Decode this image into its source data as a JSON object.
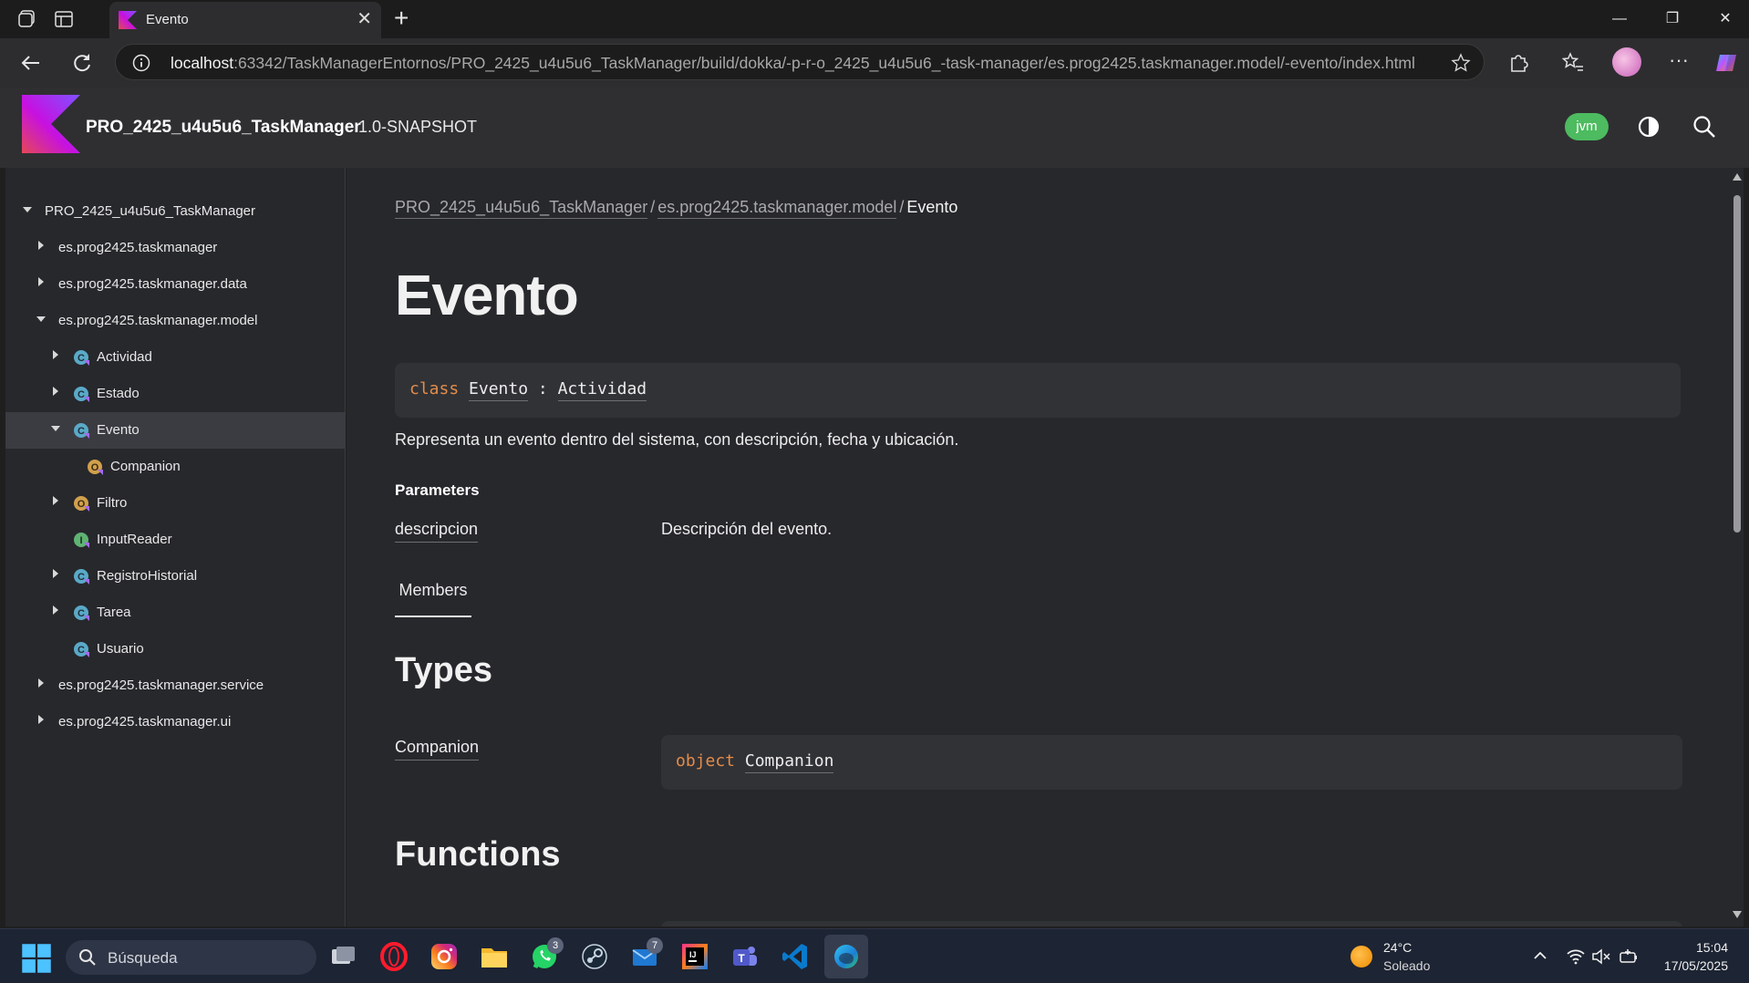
{
  "browser": {
    "tab_title": "Evento",
    "url_host": "localhost",
    "url_rest": ":63342/TaskManagerEntornos/PRO_2425_u4u5u6_TaskManager/build/dokka/-p-r-o_2425_u4u5u6_-task-manager/es.prog2425.taskmanager.model/-evento/index.html"
  },
  "header": {
    "project": "PRO_2425_u4u5u6_TaskManager",
    "version": "1.0-SNAPSHOT",
    "platform_badge": "jvm"
  },
  "sidebar": {
    "items": [
      {
        "label": "PRO_2425_u4u5u6_TaskManager",
        "expanded": true
      },
      {
        "label": "es.prog2425.taskmanager",
        "expanded": false
      },
      {
        "label": "es.prog2425.taskmanager.data",
        "expanded": false
      },
      {
        "label": "es.prog2425.taskmanager.model",
        "expanded": true
      },
      {
        "label": "Actividad",
        "expanded": false,
        "icon": "class-icon"
      },
      {
        "label": "Estado",
        "expanded": false,
        "icon": "class-icon"
      },
      {
        "label": "Evento",
        "expanded": true,
        "icon": "class-icon",
        "selected": true
      },
      {
        "label": "Companion",
        "icon": "object-icon"
      },
      {
        "label": "Filtro",
        "expanded": false,
        "icon": "object-icon"
      },
      {
        "label": "InputReader",
        "icon": "class-icon-green"
      },
      {
        "label": "RegistroHistorial",
        "expanded": false,
        "icon": "class-icon"
      },
      {
        "label": "Tarea",
        "expanded": false,
        "icon": "class-icon"
      },
      {
        "label": "Usuario",
        "icon": "class-icon"
      },
      {
        "label": "es.prog2425.taskmanager.service",
        "expanded": false
      },
      {
        "label": "es.prog2425.taskmanager.ui",
        "expanded": false
      }
    ]
  },
  "content": {
    "breadcrumbs": [
      "PRO_2425_u4u5u6_TaskManager",
      "es.prog2425.taskmanager.model",
      "Evento"
    ],
    "breadcrumb_sep": "/",
    "title": "Evento",
    "signature": {
      "keyword": "class",
      "name": "Evento",
      "sep": ":",
      "supertype": "Actividad"
    },
    "description": "Representa un evento dentro del sistema, con descripción, fecha y ubicación.",
    "parameters_title": "Parameters",
    "parameters": [
      {
        "name": "descripcion",
        "description": "Descripción del evento."
      }
    ],
    "members_tab": "Members",
    "types_heading": "Types",
    "types": [
      {
        "name": "Companion",
        "keyword": "object",
        "sig_name": "Companion"
      }
    ],
    "functions_heading": "Functions"
  },
  "taskbar": {
    "search_label": "Búsqueda",
    "whatsapp_badge": "3",
    "mail_badge": "7",
    "weather_temp": "24°C",
    "weather_cond": "Soleado",
    "time": "15:04",
    "date": "17/05/2025"
  },
  "colors": {
    "accent_keyword": "#e38c4a",
    "jvm_badge": "#4dbb5f",
    "page_bg": "#27282c",
    "header_bg": "#2f2f32"
  }
}
